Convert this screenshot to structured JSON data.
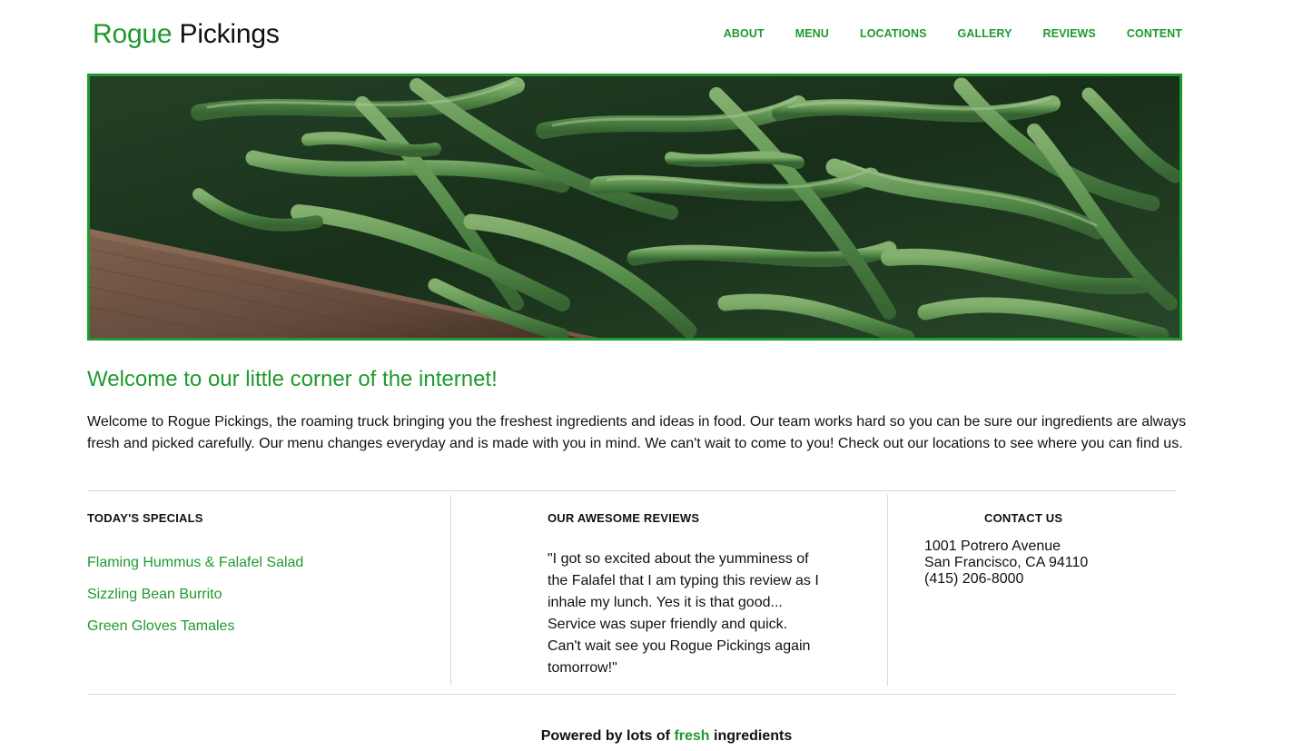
{
  "brand": {
    "first": "Rogue",
    "second": "Pickings"
  },
  "nav": {
    "items": [
      {
        "label": "ABOUT"
      },
      {
        "label": "MENU"
      },
      {
        "label": "LOCATIONS"
      },
      {
        "label": "GALLERY"
      },
      {
        "label": "REVIEWS"
      },
      {
        "label": "CONTENT"
      }
    ]
  },
  "welcome": {
    "title": "Welcome to our little corner of the internet!",
    "text": "Welcome to Rogue Pickings, the roaming truck bringing you the freshest ingredients and ideas in food. Our team works hard so you can be sure our ingredients are always fresh and picked carefully. Our menu changes everyday and is made with you in mind. We can't wait to come to you! Check out our locations to see where you can find us."
  },
  "specials": {
    "title": "TODAY'S SPECIALS",
    "items": [
      {
        "label": "Flaming Hummus & Falafel Salad"
      },
      {
        "label": "Sizzling Bean Burrito"
      },
      {
        "label": "Green Gloves Tamales"
      }
    ]
  },
  "reviews": {
    "title": "OUR AWESOME REVIEWS",
    "text": "\"I got so excited about the yumminess of the Falafel that I am typing this review as I inhale my lunch. Yes it is that good... Service was super friendly and quick. Can't wait see you Rogue Pickings again tomorrow!\""
  },
  "contact": {
    "title": "CONTACT US",
    "address1": "1001 Potrero Avenue",
    "address2": "San Francisco, CA 94110",
    "phone": "(415) 206-8000"
  },
  "footer": {
    "before": "Powered by lots of ",
    "highlight": "fresh",
    "after": " ingredients"
  },
  "colors": {
    "accent": "#1f9a2e",
    "text": "#111111",
    "divider": "#d8d8d8"
  },
  "hero": {
    "image": "green beans in a wooden crate"
  }
}
